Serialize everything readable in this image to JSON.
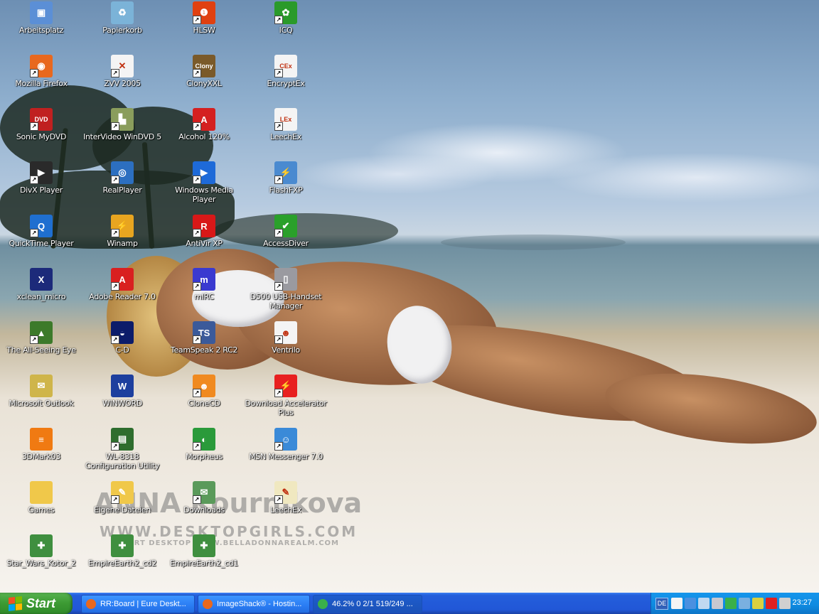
{
  "desktop": {
    "watermark": {
      "name": "ANNA Kournikova",
      "site": "WWW.DESKTOPGIRLS.COM",
      "sub": "ART DESKTOP    WWW.BELLADONNAREALM.COM"
    },
    "icons": [
      {
        "label": "Arbeitsplatz",
        "icon": "computer-icon",
        "color": "#5b8fd6",
        "glyph": "▣",
        "shortcut": false
      },
      {
        "label": "Mozilla Firefox",
        "icon": "firefox-icon",
        "color": "#e8681e",
        "glyph": "◉",
        "shortcut": true
      },
      {
        "label": "Sonic MyDVD",
        "icon": "dvd-icon",
        "color": "#c02020",
        "glyph": "DVD",
        "shortcut": true
      },
      {
        "label": "DivX Player",
        "icon": "divx-player-icon",
        "color": "#2a2a2a",
        "glyph": "▶",
        "shortcut": true
      },
      {
        "label": "QuickTime Player",
        "icon": "quicktime-icon",
        "color": "#1f6fd0",
        "glyph": "Q",
        "shortcut": true
      },
      {
        "label": "xclean_micro",
        "icon": "xclean-icon",
        "color": "#1c2a7a",
        "glyph": "X",
        "shortcut": false
      },
      {
        "label": "The All-Seeing Eye",
        "icon": "all-seeing-eye-icon",
        "color": "#3c7a2a",
        "glyph": "▲",
        "shortcut": true
      },
      {
        "label": "Microsoft Outlook",
        "icon": "outlook-icon",
        "color": "#cfb54a",
        "glyph": "✉",
        "shortcut": false
      },
      {
        "label": "3DMark03",
        "icon": "3dmark-icon",
        "color": "#f07a12",
        "glyph": "≡",
        "shortcut": false
      },
      {
        "label": "Games",
        "icon": "folder-icon",
        "color": "#f0c84a",
        "glyph": "",
        "shortcut": false
      },
      {
        "label": "Star_Wars_Kotor_2",
        "icon": "puzzle-icon",
        "color": "#3f8f3f",
        "glyph": "✚",
        "shortcut": false
      },
      {
        "label": "Papierkorb",
        "icon": "recycle-bin-icon",
        "color": "#7bb3d8",
        "glyph": "♻",
        "shortcut": false
      },
      {
        "label": "ZVV 2005",
        "icon": "zvv-icon",
        "color": "#f4f4f4",
        "glyph": "✕",
        "shortcut": true
      },
      {
        "label": "InterVideo WinDVD 5",
        "icon": "windvd-icon",
        "color": "#8a9d5c",
        "glyph": "▙",
        "shortcut": true
      },
      {
        "label": "RealPlayer",
        "icon": "realplayer-icon",
        "color": "#2c6fc0",
        "glyph": "◎",
        "shortcut": true
      },
      {
        "label": "Winamp",
        "icon": "winamp-icon",
        "color": "#e8a520",
        "glyph": "⚡",
        "shortcut": true
      },
      {
        "label": "Adobe Reader 7.0",
        "icon": "adobe-reader-icon",
        "color": "#d92020",
        "glyph": "A",
        "shortcut": true
      },
      {
        "label": "C-D",
        "icon": "cd-icon",
        "color": "#0c1c6a",
        "glyph": "◒",
        "shortcut": true
      },
      {
        "label": "WINWORD",
        "icon": "word-icon",
        "color": "#1d3f9e",
        "glyph": "W",
        "shortcut": false
      },
      {
        "label": "WL-8318 Configuration Utility",
        "icon": "network-card-icon",
        "color": "#2e6d2e",
        "glyph": "▤",
        "shortcut": true
      },
      {
        "label": "Eigene Dateien",
        "icon": "my-documents-icon",
        "color": "#f0c84a",
        "glyph": "✎",
        "shortcut": true
      },
      {
        "label": "EmpireEarth2_cd2",
        "icon": "puzzle-icon",
        "color": "#3f8f3f",
        "glyph": "✚",
        "shortcut": false
      },
      {
        "label": "HLSW",
        "icon": "hlsw-icon",
        "color": "#e04010",
        "glyph": "❶",
        "shortcut": true
      },
      {
        "label": "ClonyXXL",
        "icon": "clonyxxl-icon",
        "color": "#7a5a2a",
        "glyph": "Clony",
        "shortcut": true
      },
      {
        "label": "Alcohol 120%",
        "icon": "alcohol-icon",
        "color": "#d42020",
        "glyph": "A",
        "shortcut": true
      },
      {
        "label": "Windows Media Player",
        "icon": "media-player-icon",
        "color": "#1e6ad8",
        "glyph": "▶",
        "shortcut": true
      },
      {
        "label": "AntiVir XP",
        "icon": "antivir-icon",
        "color": "#d81818",
        "glyph": "R",
        "shortcut": true
      },
      {
        "label": "mIRC",
        "icon": "mirc-icon",
        "color": "#3a3ad0",
        "glyph": "m",
        "shortcut": true
      },
      {
        "label": "TeamSpeak 2 RC2",
        "icon": "teamspeak-icon",
        "color": "#3b5a9a",
        "glyph": "TS",
        "shortcut": true
      },
      {
        "label": "CloneCD",
        "icon": "clonecd-icon",
        "color": "#f08a20",
        "glyph": "☻",
        "shortcut": true
      },
      {
        "label": "Morpheus",
        "icon": "morpheus-icon",
        "color": "#2a9a3a",
        "glyph": "◐",
        "shortcut": true
      },
      {
        "label": "Downloads",
        "icon": "folder-icon",
        "color": "#5a9a5a",
        "glyph": "✉",
        "shortcut": true
      },
      {
        "label": "EmpireEarth2_cd1",
        "icon": "puzzle-icon",
        "color": "#3f8f3f",
        "glyph": "✚",
        "shortcut": false
      },
      {
        "label": "ICQ",
        "icon": "icq-icon",
        "color": "#2a9a2a",
        "glyph": "✿",
        "shortcut": true
      },
      {
        "label": "EncryptEx",
        "icon": "encryptex-icon",
        "color": "#f4f4f4",
        "glyph": "CEx",
        "shortcut": true
      },
      {
        "label": "LeechEx",
        "icon": "leechex-icon",
        "color": "#f4f4f4",
        "glyph": "LEx",
        "shortcut": true
      },
      {
        "label": "FlashFXP",
        "icon": "flashfxp-icon",
        "color": "#4a8ad0",
        "glyph": "⚡",
        "shortcut": true
      },
      {
        "label": "AccessDiver",
        "icon": "accessdiver-icon",
        "color": "#2aa02a",
        "glyph": "✔",
        "shortcut": true
      },
      {
        "label": "D500 USB-Handset Manager",
        "icon": "handset-icon",
        "color": "#9a9aa0",
        "glyph": "▯",
        "shortcut": true
      },
      {
        "label": "Ventrilo",
        "icon": "ventrilo-icon",
        "color": "#f4f4f4",
        "glyph": "☻",
        "shortcut": true
      },
      {
        "label": "Download Accelerator Plus",
        "icon": "download-accelerator-icon",
        "color": "#e82020",
        "glyph": "⚡",
        "shortcut": true
      },
      {
        "label": "MSN Messenger 7.0",
        "icon": "msn-messenger-icon",
        "color": "#3a8ad8",
        "glyph": "☺",
        "shortcut": true
      },
      {
        "label": "LeechEx",
        "icon": "leechex-notes-icon",
        "color": "#f0e8c0",
        "glyph": "✎",
        "shortcut": true
      }
    ]
  },
  "taskbar": {
    "start_label": "Start",
    "tasks": [
      {
        "label": "RR:Board | Eure Deskt...",
        "icon": "firefox-icon",
        "color": "#e8681e",
        "active": false
      },
      {
        "label": "ImageShack® - Hostin...",
        "icon": "firefox-icon",
        "color": "#e8681e",
        "active": false
      },
      {
        "label": "46.2% 0 2/1 519/249 ...",
        "icon": "download-progress-icon",
        "color": "#3ab04a",
        "active": true
      }
    ],
    "tray": {
      "language": "DE",
      "clock": "23:27",
      "icons": [
        "help-icon",
        "network-icon",
        "zoom-icon",
        "display-icon",
        "signal-icon",
        "volume-icon",
        "security-icon",
        "antivir-tray-icon",
        "speaker-icon"
      ]
    }
  }
}
